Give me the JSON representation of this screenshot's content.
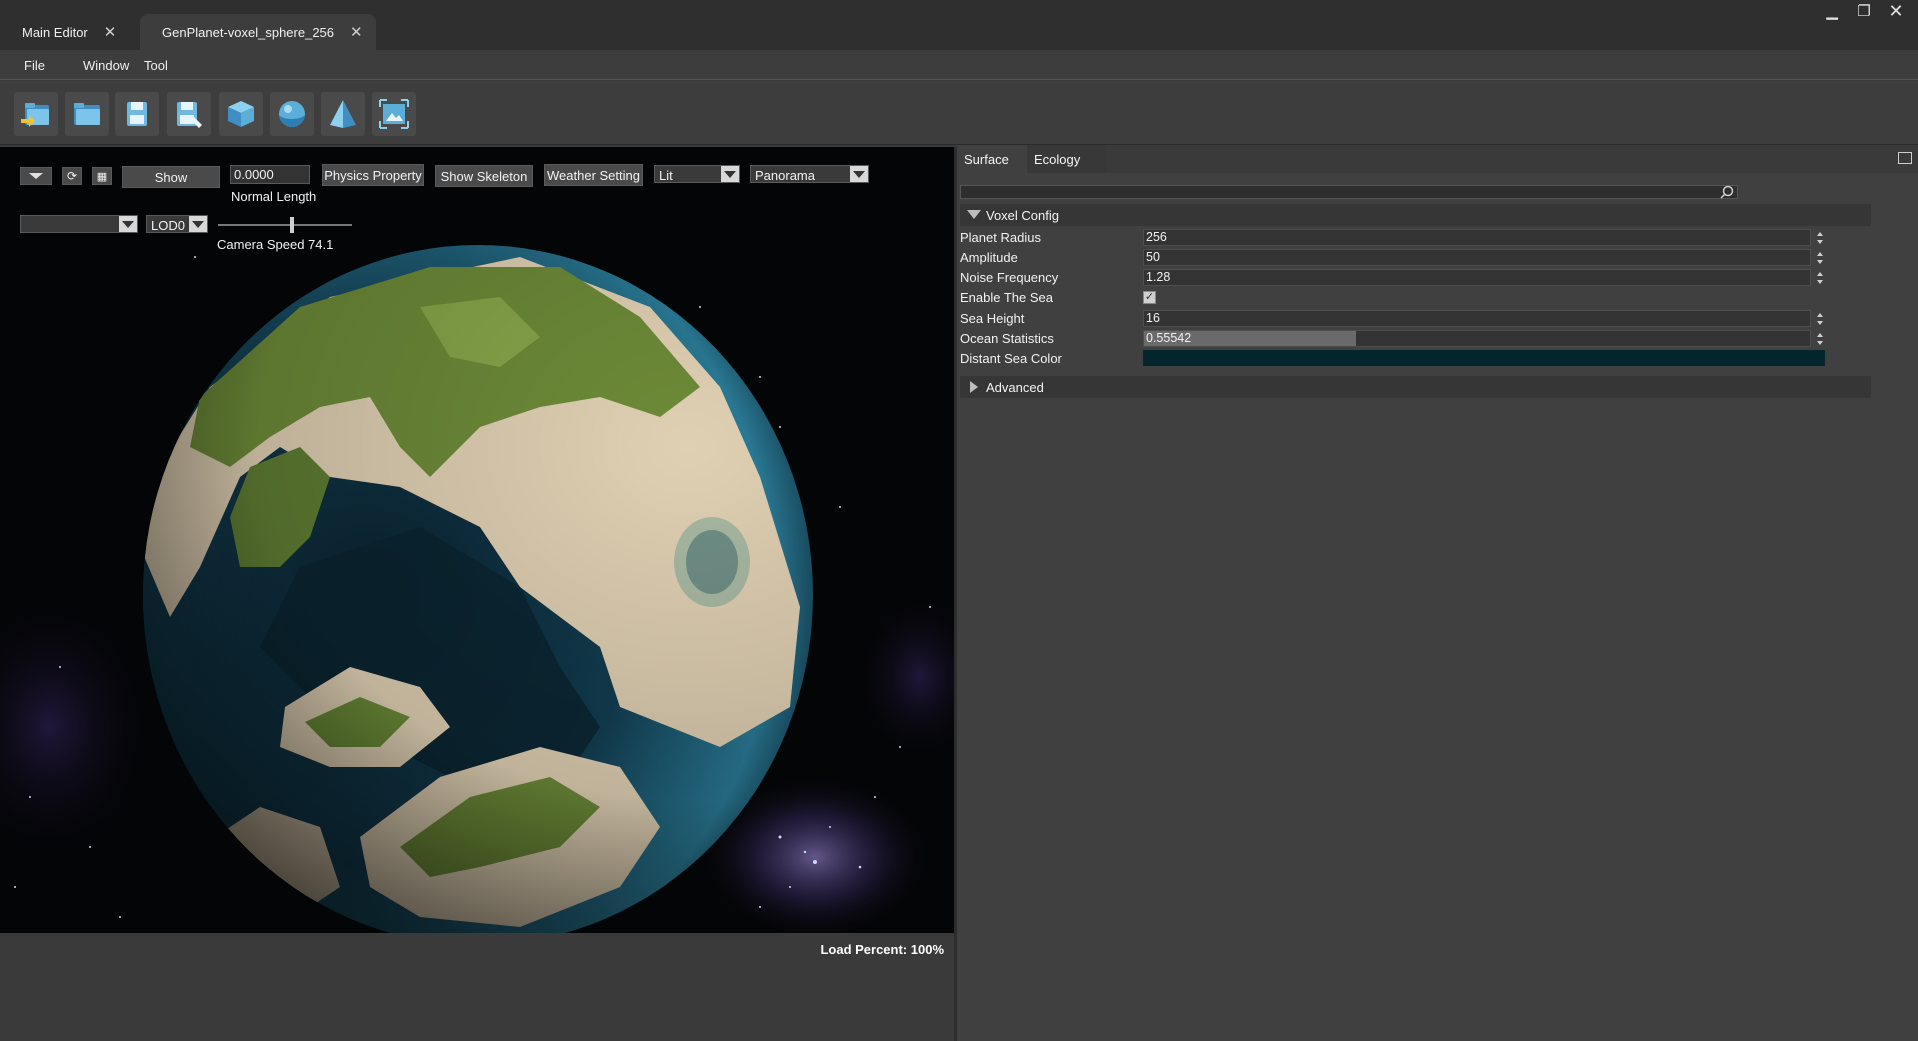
{
  "tabs": [
    {
      "label": "Main Editor"
    },
    {
      "label": "GenPlanet-voxel_sphere_256"
    }
  ],
  "menu": [
    "File",
    "Window",
    "Tool"
  ],
  "toolbar": {
    "icons": [
      "import-folder-icon",
      "open-folder-icon",
      "save-icon",
      "save-as-icon",
      "cube-icon",
      "sphere-icon",
      "pyramid-icon",
      "frame-image-icon"
    ]
  },
  "viewport": {
    "show_label": "Show",
    "normal_length_value": "0.0000",
    "normal_length_label": "Normal Length",
    "physics_property_label": "Physics Property",
    "show_skeleton_label": "Show Skeleton",
    "weather_setting_label": "Weather Setting",
    "shading_mode": "Lit",
    "background_mode": "Panorama",
    "lod_value": "LOD0",
    "camera_speed_label": "Camera Speed 74.1",
    "camera_speed_level": 0.55
  },
  "status": {
    "load_percent": "Load Percent: 100%"
  },
  "panel": {
    "tabs": [
      "Surface",
      "Ecology"
    ],
    "search_placeholder": "",
    "sections": {
      "voxel_config": "Voxel Config",
      "advanced": "Advanced"
    },
    "properties": {
      "planet_radius": {
        "label": "Planet Radius",
        "value": "256"
      },
      "amplitude": {
        "label": "Amplitude",
        "value": "50"
      },
      "noise_frequency": {
        "label": "Noise Frequency",
        "value": "1.28"
      },
      "enable_sea": {
        "label": "Enable The Sea",
        "checked": true
      },
      "sea_height": {
        "label": "Sea Height",
        "value": "16"
      },
      "ocean_statistics": {
        "label": "Ocean Statistics",
        "value": "0.55542",
        "fill": 0.55542
      },
      "distant_sea_color": {
        "label": "Distant Sea Color",
        "color": "#03262e"
      }
    }
  },
  "colors": {
    "accent": "#5aaed8",
    "ocean": "#1a4f66",
    "land_green": "#6f8f3a",
    "land_sand": "#e3d4b9"
  }
}
